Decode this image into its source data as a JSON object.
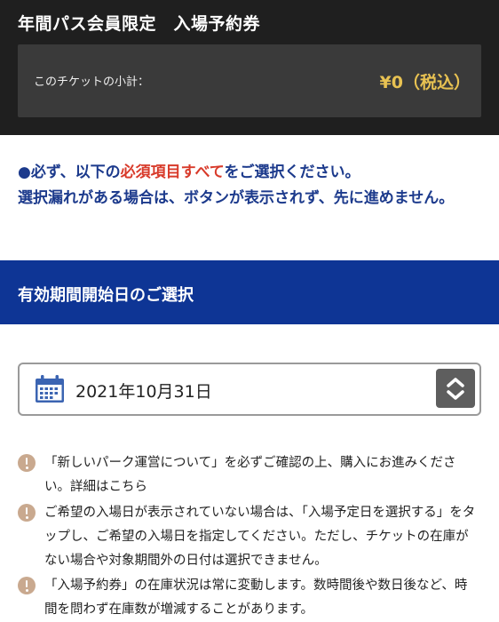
{
  "header": {
    "title": "年間パス会員限定　入場予約券",
    "subtotal_label": "このチケットの小計：",
    "subtotal_value": "¥0（税込）"
  },
  "notice": {
    "line1_prefix": "●必ず、以下の",
    "line1_highlight": "必須項目すべて",
    "line1_suffix": "をご選択ください。",
    "line2": "選択漏れがある場合は、ボタンが表示されず、先に進めません。"
  },
  "section": {
    "title": "有効期間開始日のご選択"
  },
  "date_select": {
    "value": "2021年10月31日",
    "icon": "calendar-icon",
    "stepper_icon": "up-down-arrows-icon"
  },
  "info": [
    {
      "text": "「新しいパーク運営について」を必ずご確認の上、購入にお進みください。詳細はこちら"
    },
    {
      "text": "ご希望の入場日が表示されていない場合は、「入場予定日を選択する」をタップし、ご希望の入場日を指定してください。ただし、チケットの在庫がない場合や対象期間外の日付は選択できません。"
    },
    {
      "text": "「入場予約券」の在庫状況は常に変動します。数時間後や数日後など、時間を問わず在庫数が増減することがあります。"
    }
  ],
  "colors": {
    "header_bg": "#1f1f1f",
    "subtotal_bg": "#3a3a3a",
    "price": "#e8c252",
    "notice_blue": "#1c3a8c",
    "notice_red": "#d83a2a",
    "section_bg": "#0e3595",
    "info_icon": "#c9a98f"
  }
}
